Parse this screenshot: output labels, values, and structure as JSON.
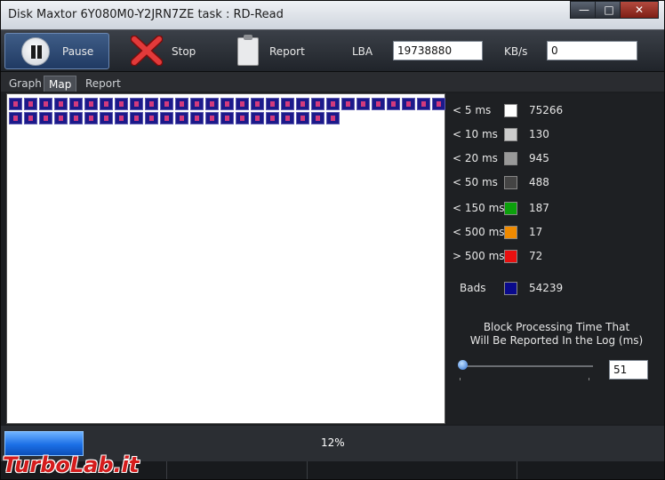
{
  "window": {
    "title": "Disk Maxtor 6Y080M0-Y2JRN7ZE   task : RD-Read",
    "controls": {
      "minimize": "—",
      "maximize": "□",
      "close": "✕"
    }
  },
  "toolbar": {
    "pause_label": "Pause",
    "stop_label": "Stop",
    "report_label": "Report",
    "lba_label": "LBA",
    "lba_value": "19738880",
    "kbs_label": "KB/s",
    "kbs_value": "0",
    "icons": {
      "pause": "pause-icon",
      "stop": "stop-x-icon",
      "report": "clipboard-icon"
    }
  },
  "tabs": [
    {
      "label": "Graph",
      "active": false
    },
    {
      "label": "Map",
      "active": true
    },
    {
      "label": "Report",
      "active": false
    }
  ],
  "map": {
    "block_rows": [
      29,
      22
    ],
    "block_color": "#1c1a8a"
  },
  "legend": {
    "items": [
      {
        "label": "< 5 ms",
        "color": "#ffffff",
        "count": "75266"
      },
      {
        "label": "< 10 ms",
        "color": "#cccccc",
        "count": "130"
      },
      {
        "label": "< 20 ms",
        "color": "#999999",
        "count": "945"
      },
      {
        "label": "< 50 ms",
        "color": "#444444",
        "count": "488"
      },
      {
        "label": "< 150 ms",
        "color": "#0ca00c",
        "count": "187"
      },
      {
        "label": "< 500 ms",
        "color": "#f08a00",
        "count": "17"
      },
      {
        "label": "> 500 ms",
        "color": "#e81010",
        "count": "72"
      },
      {
        "label": "Bads",
        "color": "#0a0a8c",
        "count": "54239"
      }
    ],
    "block_time_line1": "Block Processing Time That",
    "block_time_line2": "Will Be Reported In the Log (ms)",
    "slider_value": "51",
    "slider_fraction": 0.0
  },
  "status": {
    "progress_text": "12%",
    "progress_fraction": 0.12
  },
  "watermark": {
    "text": "TurboLab.it"
  }
}
